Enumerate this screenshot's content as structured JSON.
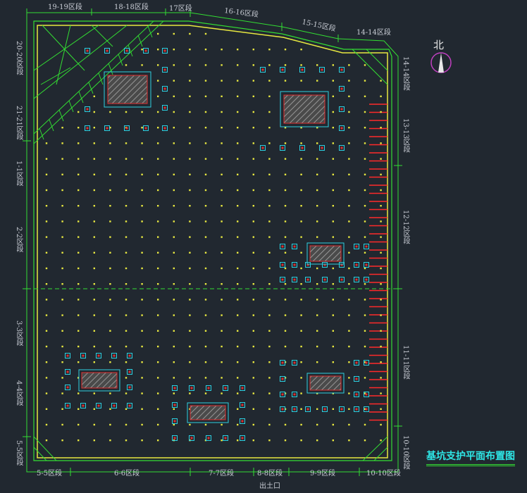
{
  "title": "基坑支护平面布置图",
  "north_label": "北",
  "exit_label": "出土口",
  "segments_top": [
    "19-19区段",
    "18-18区段",
    "17区段",
    "16-16区段",
    "15-15区段",
    "14-14区段"
  ],
  "segments_left": [
    "20-20区段",
    "21-21区段",
    "1-1区段",
    "2-2区段",
    "3-3区段",
    "4-4区段",
    "5-5区段"
  ],
  "segments_right": [
    "14-14区段",
    "13-13区段",
    "12-12区段",
    "11-11区段",
    "10-10区段"
  ],
  "segments_bottom": [
    "5-5区段",
    "6-6区段",
    "7-7区段",
    "8-8区段",
    "9-9区段",
    "10-10区段"
  ],
  "colors": {
    "background": "#212830",
    "boundary": "#33dd33",
    "inner_wall": "#e8e840",
    "pile_dot": "#e8e840",
    "column_box": "#2ecfe0",
    "column_core": "#e03030",
    "brace_line": "#ff2a2a",
    "title": "#2ee6e6",
    "label": "#c8ccd4"
  }
}
